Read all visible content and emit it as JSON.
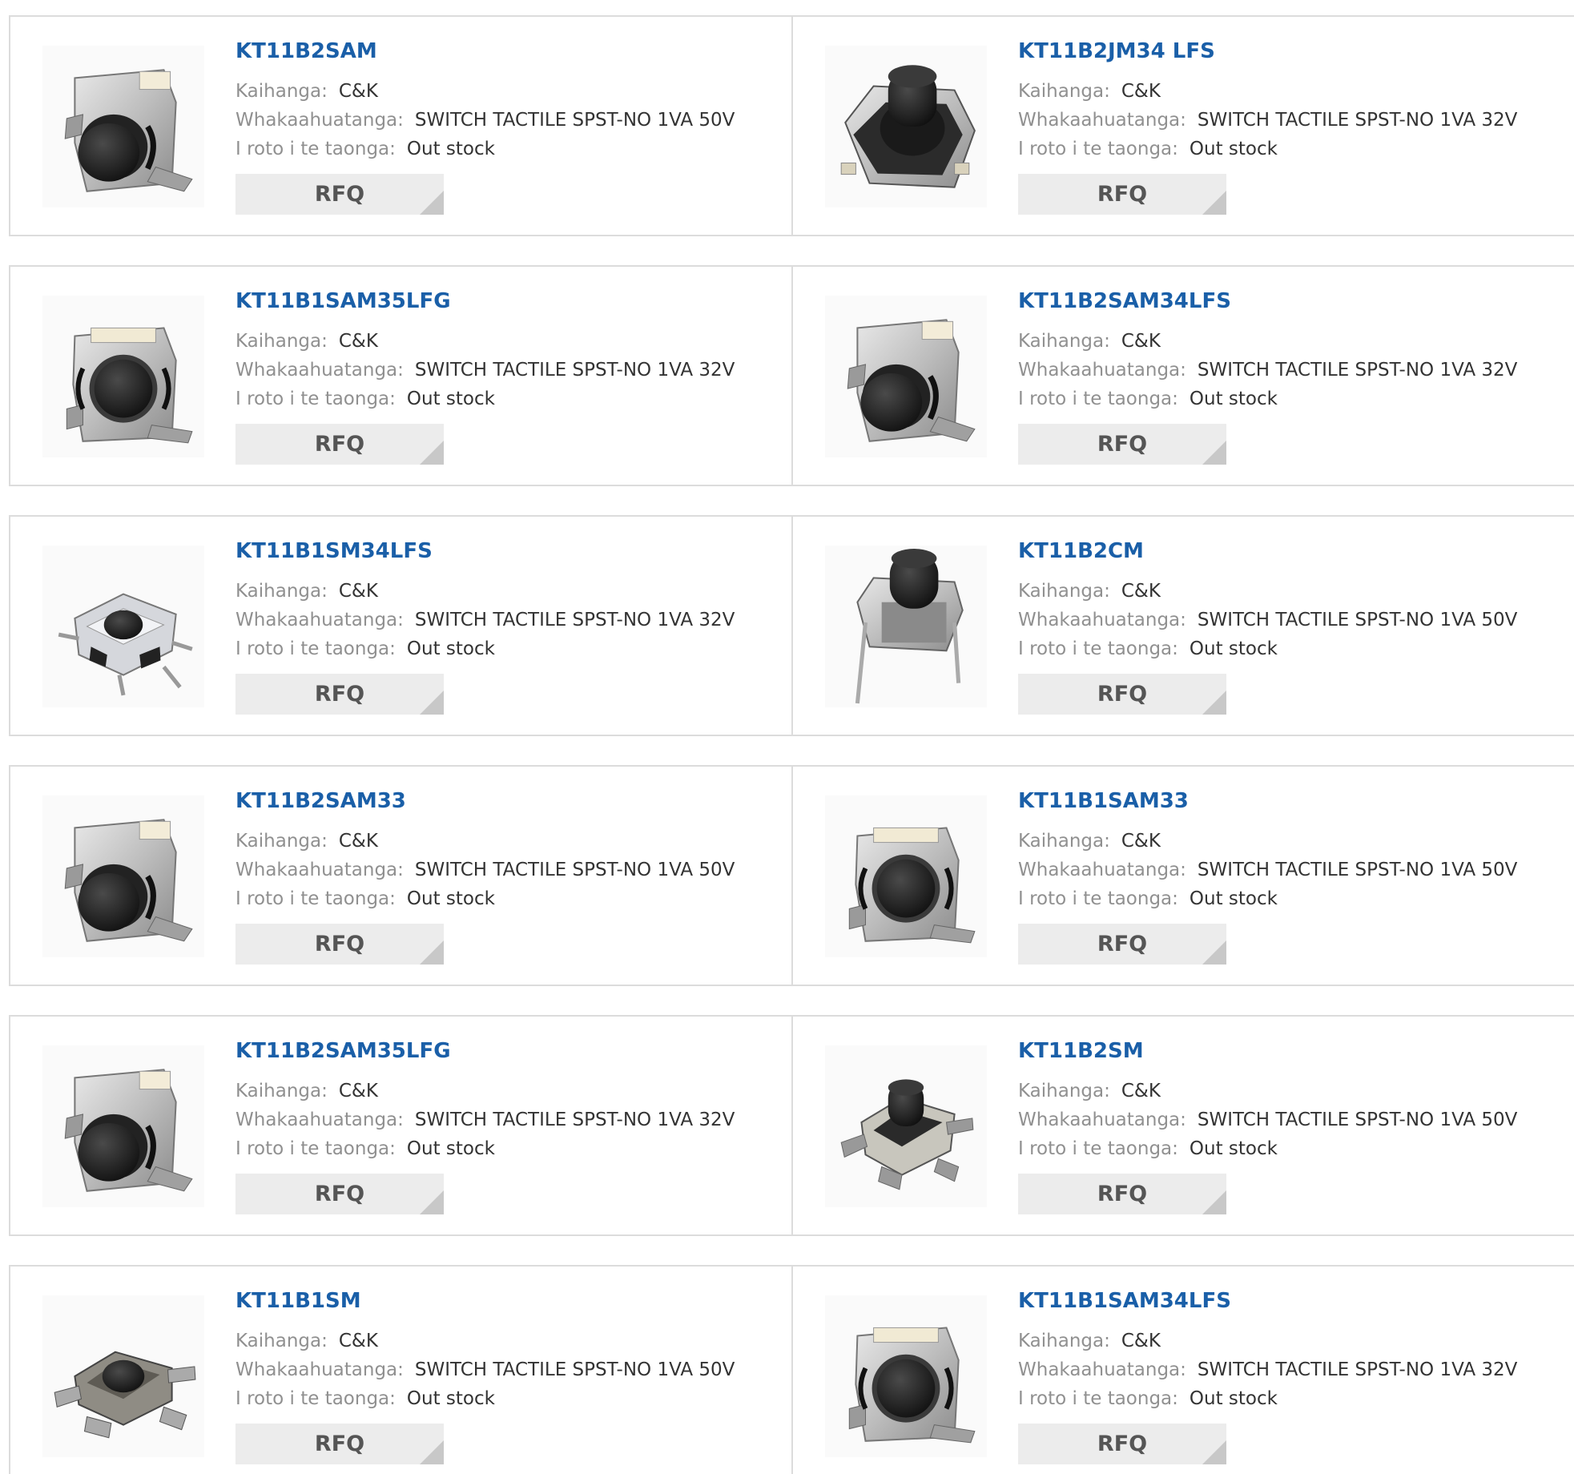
{
  "labels": {
    "manufacturer": "Kaihanga:",
    "description": "Whakaahuatanga:",
    "stock": "I roto i te taonga:",
    "rfq": "RFQ"
  },
  "products": [
    {
      "part": "KT11B2SAM",
      "manufacturer": "C&K",
      "description": "SWITCH TACTILE SPST-NO 1VA 50V",
      "stock": "Out stock",
      "icon": "tactile-switch-right-angle-icon"
    },
    {
      "part": "KT11B2JM34 LFS",
      "manufacturer": "C&K",
      "description": "SWITCH TACTILE SPST-NO 1VA 32V",
      "stock": "Out stock",
      "icon": "tactile-switch-topview-icon"
    },
    {
      "part": "KT11B1SAM35LFG",
      "manufacturer": "C&K",
      "description": "SWITCH TACTILE SPST-NO 1VA 32V",
      "stock": "Out stock",
      "icon": "tactile-switch-front-icon"
    },
    {
      "part": "KT11B2SAM34LFS",
      "manufacturer": "C&K",
      "description": "SWITCH TACTILE SPST-NO 1VA 32V",
      "stock": "Out stock",
      "icon": "tactile-switch-right-angle-icon"
    },
    {
      "part": "KT11B1SM34LFS",
      "manufacturer": "C&K",
      "description": "SWITCH TACTILE SPST-NO 1VA 32V",
      "stock": "Out stock",
      "icon": "tactile-switch-smd-icon"
    },
    {
      "part": "KT11B2CM",
      "manufacturer": "C&K",
      "description": "SWITCH TACTILE SPST-NO 1VA 50V",
      "stock": "Out stock",
      "icon": "tactile-switch-through-hole-icon"
    },
    {
      "part": "KT11B2SAM33",
      "manufacturer": "C&K",
      "description": "SWITCH TACTILE SPST-NO 1VA 50V",
      "stock": "Out stock",
      "icon": "tactile-switch-right-angle-icon"
    },
    {
      "part": "KT11B1SAM33",
      "manufacturer": "C&K",
      "description": "SWITCH TACTILE SPST-NO 1VA 50V",
      "stock": "Out stock",
      "icon": "tactile-switch-front-icon"
    },
    {
      "part": "KT11B2SAM35LFG",
      "manufacturer": "C&K",
      "description": "SWITCH TACTILE SPST-NO 1VA 32V",
      "stock": "Out stock",
      "icon": "tactile-switch-right-angle-icon"
    },
    {
      "part": "KT11B2SM",
      "manufacturer": "C&K",
      "description": "SWITCH TACTILE SPST-NO 1VA 50V",
      "stock": "Out stock",
      "icon": "tactile-switch-smd-tall-icon"
    },
    {
      "part": "KT11B1SM",
      "manufacturer": "C&K",
      "description": "SWITCH TACTILE SPST-NO 1VA 50V",
      "stock": "Out stock",
      "icon": "tactile-switch-smd-dark-icon"
    },
    {
      "part": "KT11B1SAM34LFS",
      "manufacturer": "C&K",
      "description": "SWITCH TACTILE SPST-NO 1VA 32V",
      "stock": "Out stock",
      "icon": "tactile-switch-front-icon"
    }
  ],
  "colors": {
    "link": "#1a5fa8",
    "label": "#909090",
    "value": "#333333",
    "button_bg": "#ececec",
    "border": "#dcdcdc"
  }
}
